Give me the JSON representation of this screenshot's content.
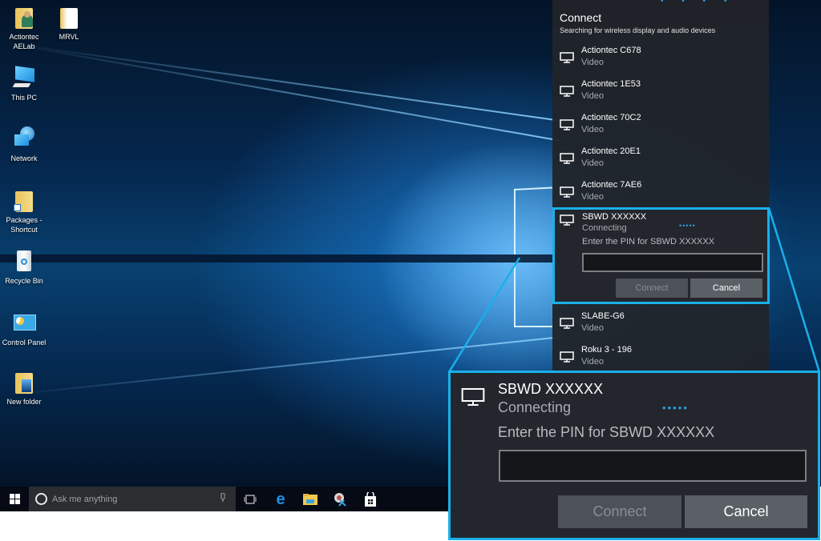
{
  "desktop": {
    "icons": [
      {
        "label_line1": "Actiontec",
        "label_line2": "AELab",
        "icon": "user-folder-icon"
      },
      {
        "label_line1": "MRVL",
        "label_line2": "",
        "icon": "folder-icon"
      },
      {
        "label_line1": "This PC",
        "label_line2": "",
        "icon": "computer-icon"
      },
      {
        "label_line1": "Network",
        "label_line2": "",
        "icon": "network-icon"
      },
      {
        "label_line1": "Packages -",
        "label_line2": "Shortcut",
        "icon": "folder-shortcut-icon"
      },
      {
        "label_line1": "Recycle Bin",
        "label_line2": "",
        "icon": "recycle-bin-icon"
      },
      {
        "label_line1": "Control Panel",
        "label_line2": "",
        "icon": "control-panel-icon"
      },
      {
        "label_line1": "New folder",
        "label_line2": "",
        "icon": "folder-icon"
      }
    ]
  },
  "taskbar": {
    "search_placeholder": "Ask me anything",
    "apps": [
      "task-view-icon",
      "edge-icon",
      "file-explorer-icon",
      "snipping-tool-icon",
      "store-icon"
    ]
  },
  "connect_panel": {
    "title": "Connect",
    "subtitle": "Searching for wireless display and audio devices",
    "devices_above": [
      {
        "name": "Actiontec C678",
        "type": "Video"
      },
      {
        "name": "Actiontec 1E53",
        "type": "Video"
      },
      {
        "name": "Actiontec 70C2",
        "type": "Video"
      },
      {
        "name": "Actiontec 20E1",
        "type": "Video"
      },
      {
        "name": "Actiontec 7AE6",
        "type": "Video"
      }
    ],
    "connecting_device": {
      "name": "SBWD XXXXXX",
      "status": "Connecting",
      "progress_dots": "•••••",
      "pin_prompt": "Enter the PIN for SBWD XXXXXX",
      "pin_value": "",
      "connect_label": "Connect",
      "cancel_label": "Cancel"
    },
    "devices_below": [
      {
        "name": "SLABE-G6",
        "type": "Video"
      },
      {
        "name": "Roku 3 - 196",
        "type": "Video"
      }
    ]
  },
  "colors": {
    "highlight": "#1ab0ea",
    "panel_bg": "#23272d",
    "progress": "#2a9ee0"
  }
}
